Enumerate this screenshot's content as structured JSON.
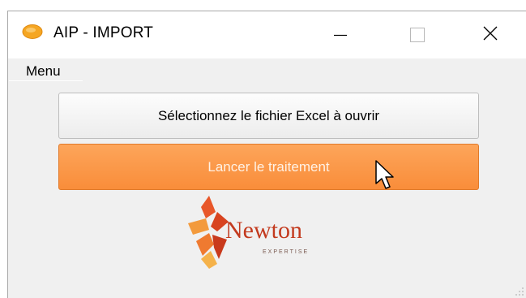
{
  "window": {
    "title": "AIP - IMPORT",
    "app_icon": "aip-logo-icon",
    "controls": [
      "minimize-icon",
      "maximize-icon",
      "close-icon"
    ]
  },
  "menu": {
    "items": [
      {
        "label": "Menu"
      }
    ]
  },
  "buttons": {
    "select_file": "Sélectionnez le fichier Excel à ouvrir",
    "launch": "Lancer le traitement"
  },
  "logo": {
    "name": "Newton",
    "tagline": "EXPERTISE",
    "color": "#c33a1e"
  },
  "colors": {
    "accent": "#f98d3a",
    "button_text_on_accent": "#fff1e4"
  }
}
